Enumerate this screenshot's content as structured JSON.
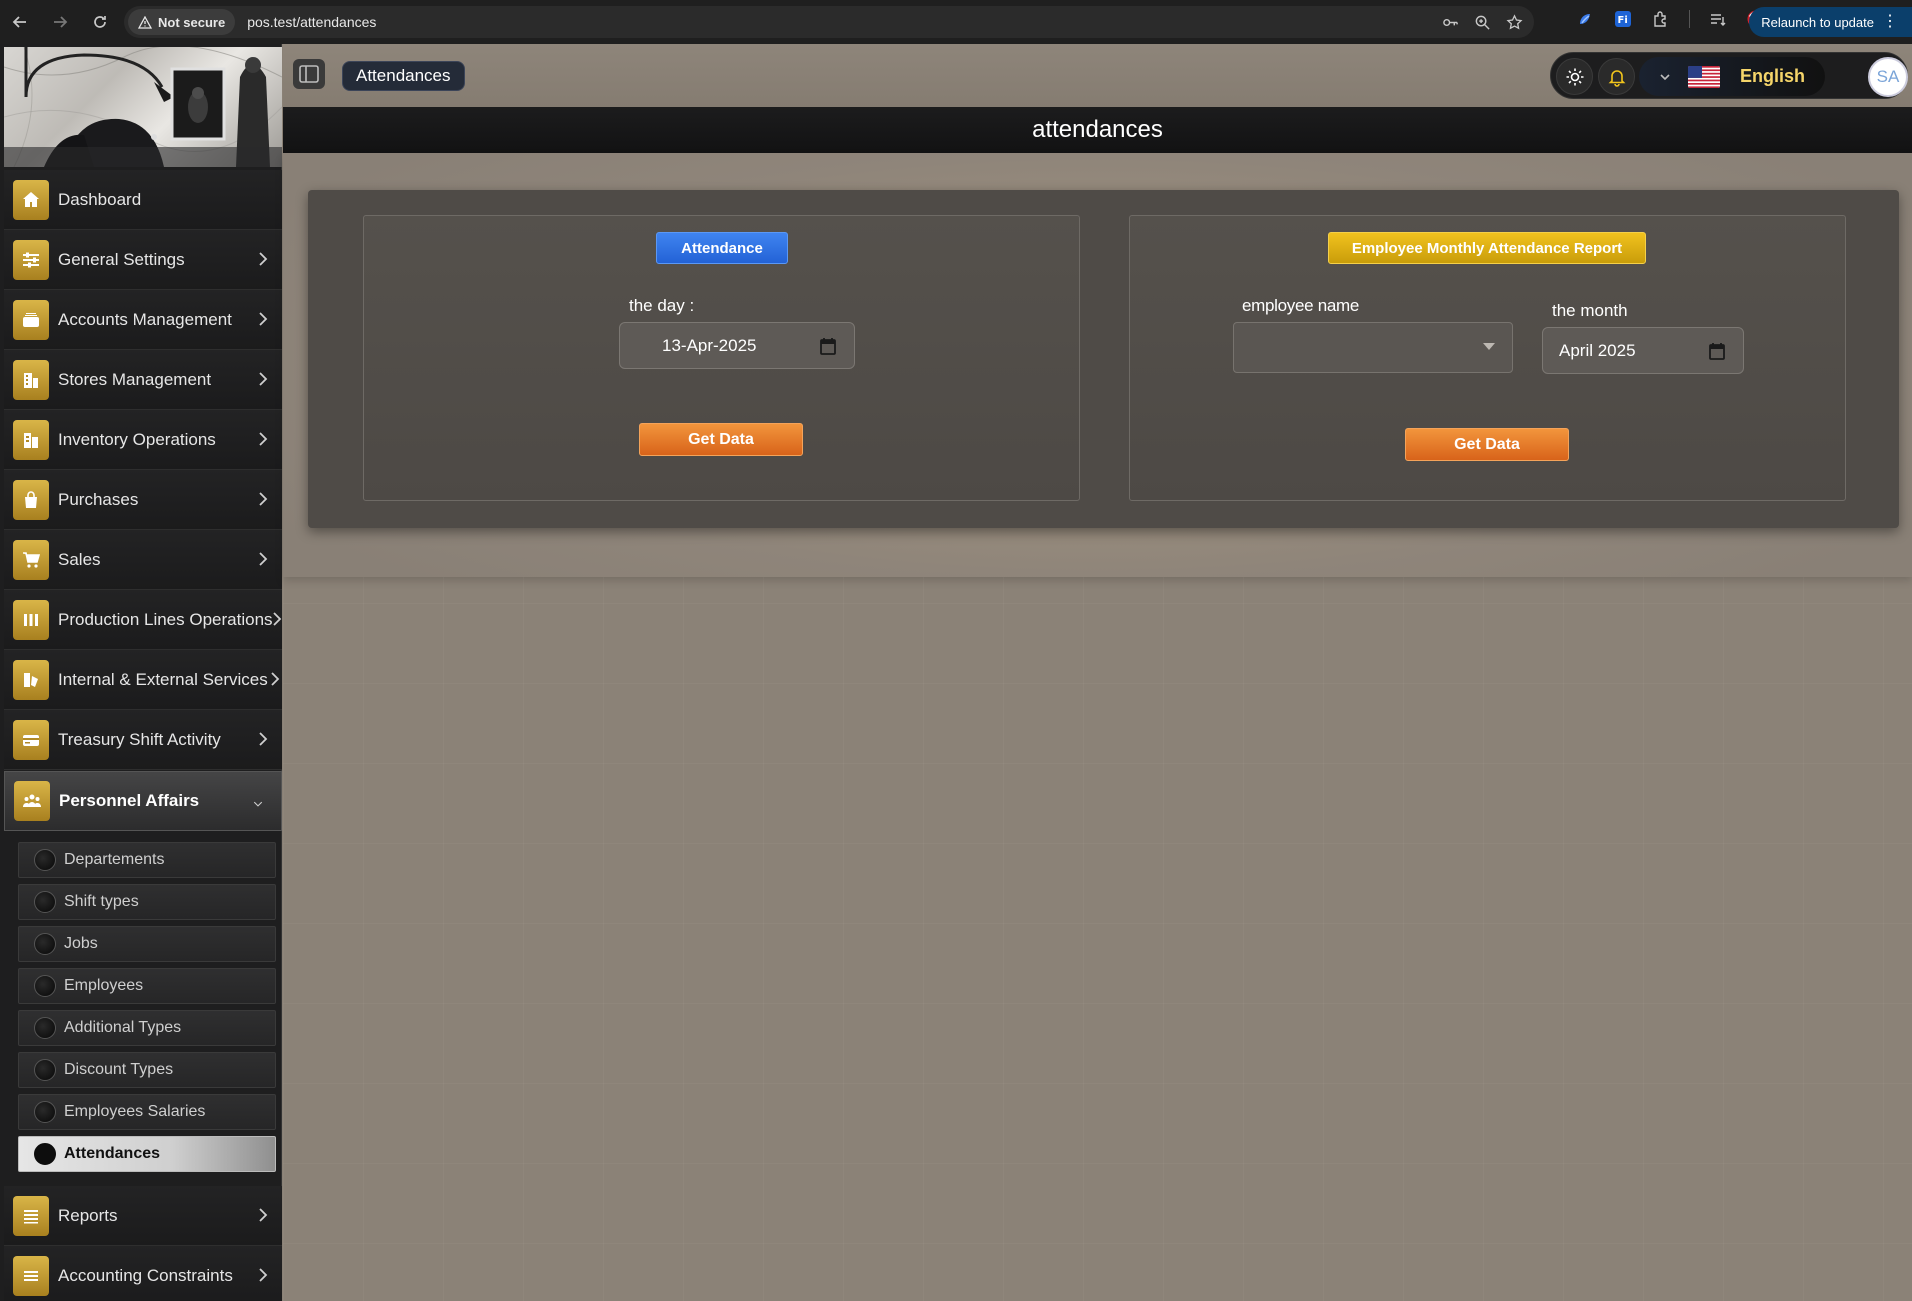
{
  "browser": {
    "security_label": "Not secure",
    "url": "pos.test/attendances",
    "relaunch_label": "Relaunch to update"
  },
  "sidebar": {
    "items": [
      {
        "label": "Dashboard",
        "icon": "home-icon"
      },
      {
        "label": "General Settings",
        "icon": "sliders-icon"
      },
      {
        "label": "Accounts Management",
        "icon": "wallet-icon"
      },
      {
        "label": "Stores Management",
        "icon": "building-icon"
      },
      {
        "label": "Inventory Operations",
        "icon": "warehouse-icon"
      },
      {
        "label": "Purchases",
        "icon": "bag-icon"
      },
      {
        "label": "Sales",
        "icon": "cart-icon"
      },
      {
        "label": "Production Lines Operations",
        "icon": "columns-icon"
      },
      {
        "label": "Internal & External Services",
        "icon": "services-icon"
      },
      {
        "label": "Treasury Shift Activity",
        "icon": "card-icon"
      },
      {
        "label": "Personnel Affairs",
        "icon": "people-icon"
      },
      {
        "label": "Reports",
        "icon": "list-icon"
      },
      {
        "label": "Accounting Constraints",
        "icon": "lines-icon"
      }
    ],
    "sub_items": [
      {
        "label": "Departements"
      },
      {
        "label": "Shift types"
      },
      {
        "label": "Jobs"
      },
      {
        "label": "Employees"
      },
      {
        "label": "Additional Types"
      },
      {
        "label": "Discount Types"
      },
      {
        "label": "Employees Salaries"
      },
      {
        "label": "Attendances"
      }
    ],
    "active_item": "Personnel Affairs",
    "active_sub_item": "Attendances"
  },
  "topbar": {
    "breadcrumb": "Attendances",
    "language": "English",
    "avatar_initials": "SA"
  },
  "page": {
    "title": "attendances"
  },
  "attendance_panel": {
    "tag": "Attendance",
    "day_label": "the day :",
    "day_value": "13-Apr-2025",
    "button": "Get Data"
  },
  "report_panel": {
    "tag": "Employee Monthly Attendance Report",
    "employee_label": "employee name",
    "employee_value": "",
    "month_label": "the month",
    "month_value": "April 2025",
    "button": "Get Data"
  },
  "colors": {
    "accent_gold": "#d9b548",
    "tag_blue": "#2f74e6",
    "tag_yellow": "#e0b414",
    "button_orange": "#e57a2a",
    "language_text": "#f5d56a"
  }
}
